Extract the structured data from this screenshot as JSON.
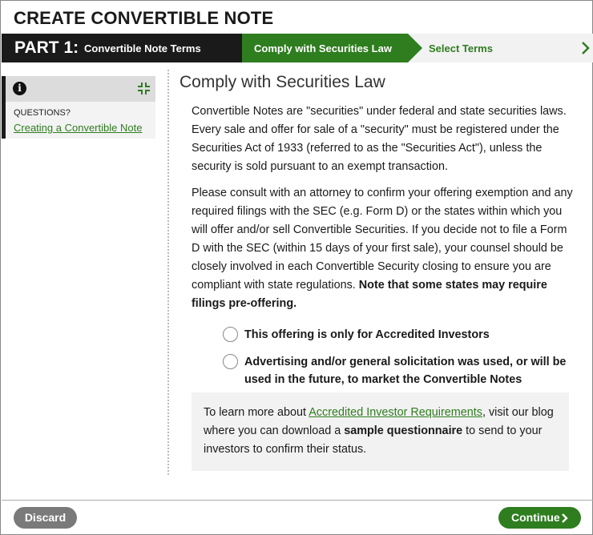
{
  "page": {
    "title": "CREATE CONVERTIBLE NOTE"
  },
  "steps": {
    "part_number": "PART 1:",
    "part_name": "Convertible Note Terms",
    "active": "Comply with Securities Law",
    "next": "Select Terms"
  },
  "sidebar": {
    "info_icon": "info-icon",
    "collapse_icon": "collapse-icon",
    "questions_label": "QUESTIONS?",
    "link": "Creating a Convertible Note"
  },
  "main": {
    "heading": "Comply with Securities Law",
    "paragraph1": "Convertible Notes are \"securities\" under federal and state securities laws. Every sale and offer for sale of a \"security\" must be registered under the Securities Act of 1933 (referred to as the \"Securities Act\"), unless the security is sold pursuant to an exempt transaction.",
    "paragraph2_text": "Please consult with an attorney to confirm your offering exemption and any required filings with the SEC (e.g. Form D) or the states within which you will offer and/or sell Convertible Securities. If you decide not to file a Form D with the SEC (within 15 days of your first sale), your counsel should be closely involved in each Convertible Security closing to ensure you are compliant with state regulations. ",
    "paragraph2_bold": "Note that some states may require filings pre-offering.",
    "options": [
      {
        "label": "This offering is only for Accredited Investors",
        "checked": false
      },
      {
        "label": "Advertising and/or general solicitation was used, or will be used in the future, to market the Convertible Notes",
        "checked": false
      }
    ],
    "note": {
      "prefix": "To learn more about ",
      "link": "Accredited Investor Requirements",
      "middle": ", visit our blog where you can download a ",
      "bold": "sample questionnaire",
      "suffix": " to send to your investors to confirm their status."
    }
  },
  "footer": {
    "discard": "Discard",
    "continue": "Continue"
  },
  "colors": {
    "accent": "#2e7d1f",
    "dark": "#1a1a1a",
    "discard": "#7a7a7a"
  }
}
